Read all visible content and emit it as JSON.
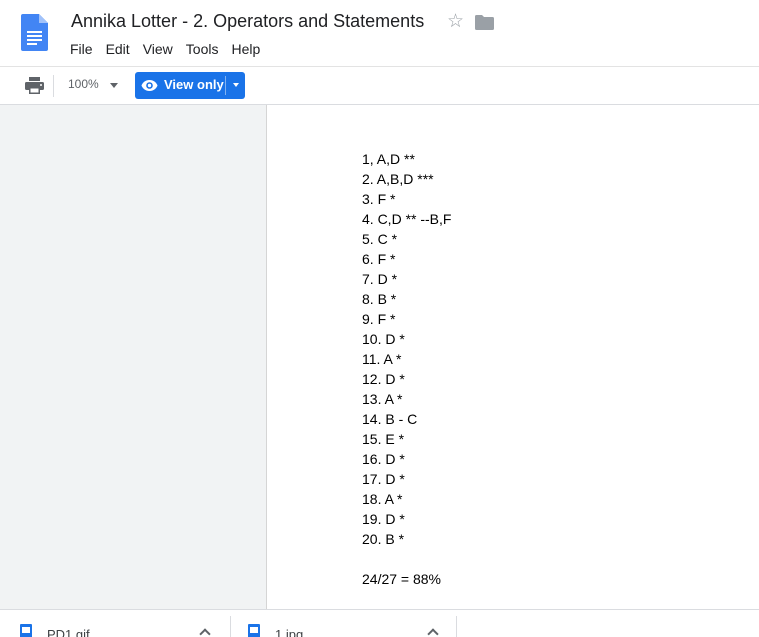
{
  "doc": {
    "title": "Annika Lotter - 2. Operators and Statements"
  },
  "menu": [
    "File",
    "Edit",
    "View",
    "Tools",
    "Help"
  ],
  "toolbar": {
    "zoom": "100%",
    "view_only_label": "View only"
  },
  "document_lines": [
    "1, A,D **",
    "2. A,B,D ***",
    "3. F *",
    "4. C,D ** --B,F",
    "5. C *",
    "6. F *",
    "7. D *",
    "8. B *",
    "9. F *",
    "10. D *",
    "11. A *",
    "12. D *",
    "13. A *",
    "14. B - C",
    "15. E *",
    "16. D *",
    "17. D *",
    "18. A *",
    "19. D *",
    "20. B *"
  ],
  "score_line": "24/27 = 88%",
  "downloads": [
    {
      "name": "PD1.gif"
    },
    {
      "name": "1.jpg"
    }
  ],
  "colors": {
    "accent": "#1a73e8",
    "doc_blue": "#4285f4"
  }
}
